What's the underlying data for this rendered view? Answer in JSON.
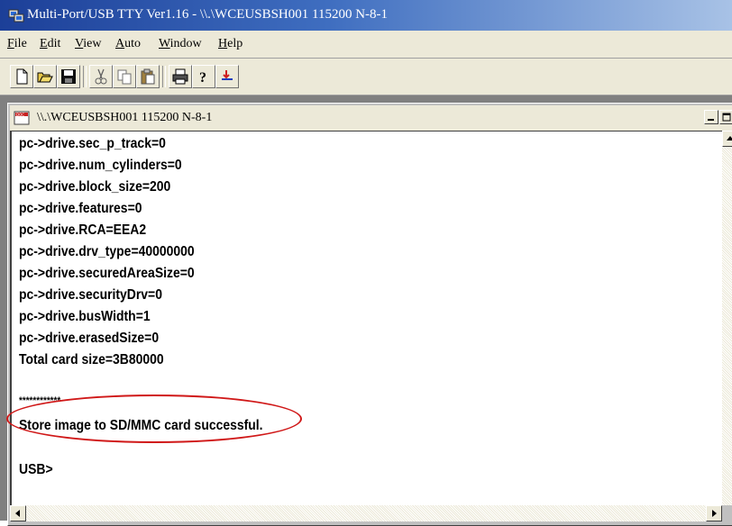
{
  "app": {
    "title": "Multi-Port/USB TTY Ver1.16 - \\\\.\\WCEUSBSH001 115200 N-8-1"
  },
  "menu": {
    "items": [
      {
        "accel": "F",
        "rest": "ile"
      },
      {
        "accel": "E",
        "rest": "dit"
      },
      {
        "accel": "V",
        "rest": "iew"
      },
      {
        "accel": "A",
        "rest": "uto"
      },
      {
        "accel": "W",
        "rest": "indow"
      },
      {
        "accel": "H",
        "rest": "elp"
      }
    ]
  },
  "toolbar": {
    "buttons": [
      "new-icon",
      "open-icon",
      "save-icon",
      "cut-icon",
      "copy-icon",
      "paste-icon",
      "print-icon",
      "help-icon",
      "connect-icon"
    ]
  },
  "child_window": {
    "title": "\\\\.\\WCEUSBSH001 115200 N-8-1"
  },
  "terminal": {
    "lines": [
      "pc->drive.sec_p_track=0",
      "pc->drive.num_cylinders=0",
      "pc->drive.block_size=200",
      "pc->drive.features=0",
      "pc->drive.RCA=EEA2",
      "pc->drive.drv_type=40000000",
      "pc->drive.securedAreaSize=0",
      "pc->drive.securityDrv=0",
      "pc->drive.busWidth=1",
      "pc->drive.erasedSize=0",
      "Total card size=3B80000",
      "",
      "************",
      "Store image to SD/MMC card successful.",
      "",
      "USB>"
    ]
  },
  "colors": {
    "highlight_ellipse": "#d01818",
    "title_bar": "#1c3f98"
  }
}
